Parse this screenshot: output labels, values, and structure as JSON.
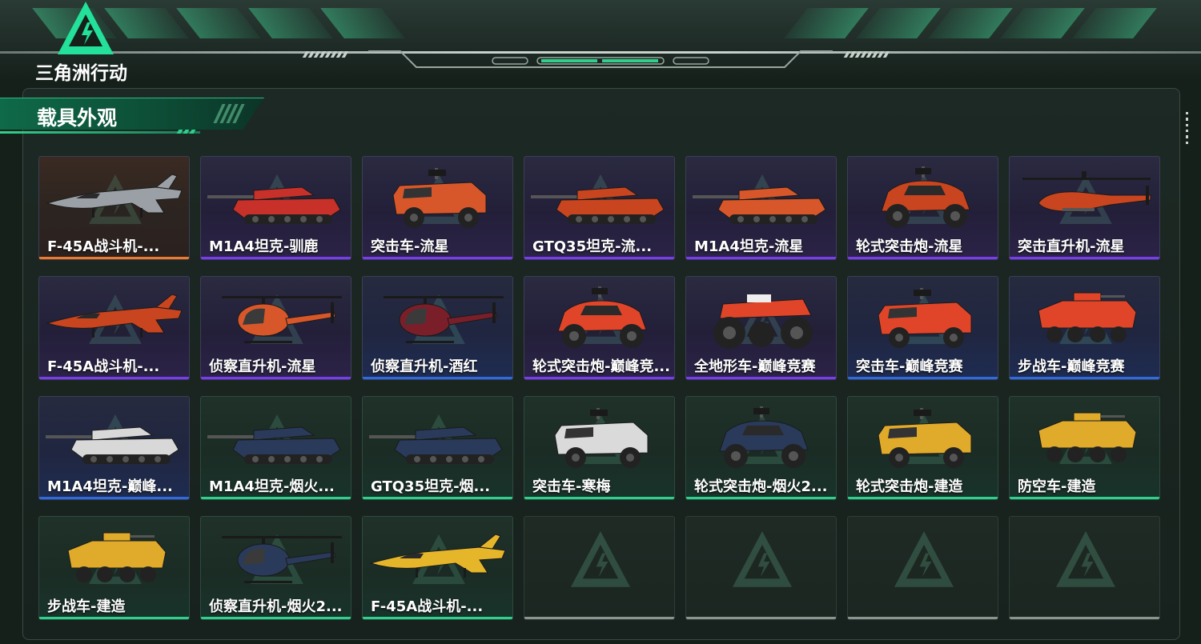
{
  "app": {
    "logo_text": "三角洲行动",
    "section_title": "载具外观"
  },
  "colors": {
    "accent": "#2fd08c",
    "rarity_purple": "#7a3cf0",
    "rarity_blue": "#2f6ae0",
    "rarity_green": "#2fd08c",
    "rarity_orange": "#f07a2a"
  },
  "vehicles": [
    {
      "name": "F-45A战斗机-...",
      "rarity": "orange",
      "type": "jet",
      "livery": "#9aa0a6"
    },
    {
      "name": "M1A4坦克-驯鹿",
      "rarity": "purple",
      "type": "tank",
      "livery": "#c8302a"
    },
    {
      "name": "突击车-流星",
      "rarity": "purple",
      "type": "mrap",
      "livery": "#d8572a"
    },
    {
      "name": "GTQ35坦克-流...",
      "rarity": "purple",
      "type": "tank",
      "livery": "#c8451f"
    },
    {
      "name": "M1A4坦克-流星",
      "rarity": "purple",
      "type": "tank",
      "livery": "#d8572a"
    },
    {
      "name": "轮式突击炮-流星",
      "rarity": "purple",
      "type": "buggy",
      "livery": "#c8451f"
    },
    {
      "name": "突击直升机-流星",
      "rarity": "purple",
      "type": "heli_attack",
      "livery": "#c8451f"
    },
    {
      "name": "F-45A战斗机-...",
      "rarity": "purple",
      "type": "jet",
      "livery": "#c8451f"
    },
    {
      "name": "侦察直升机-流星",
      "rarity": "purple",
      "type": "heli",
      "livery": "#d8572a"
    },
    {
      "name": "侦察直升机-酒红",
      "rarity": "blue",
      "type": "heli",
      "livery": "#7a1f2a"
    },
    {
      "name": "轮式突击炮-巅峰竞...",
      "rarity": "purple",
      "type": "buggy",
      "livery": "#e0452a"
    },
    {
      "name": "全地形车-巅峰竞赛",
      "rarity": "purple",
      "type": "atv",
      "livery": "#e0452a"
    },
    {
      "name": "突击车-巅峰竞赛",
      "rarity": "blue",
      "type": "mrap",
      "livery": "#e0452a"
    },
    {
      "name": "步战车-巅峰竞赛",
      "rarity": "blue",
      "type": "apc",
      "livery": "#e0452a"
    },
    {
      "name": "M1A4坦克-巅峰...",
      "rarity": "blue",
      "type": "tank",
      "livery": "#d8d8d8"
    },
    {
      "name": "M1A4坦克-烟火...",
      "rarity": "green",
      "type": "tank",
      "livery": "#2a3a5a"
    },
    {
      "name": "GTQ35坦克-烟...",
      "rarity": "green",
      "type": "tank",
      "livery": "#2a3a5a"
    },
    {
      "name": "突击车-寒梅",
      "rarity": "green",
      "type": "mrap",
      "livery": "#dadada"
    },
    {
      "name": "轮式突击炮-烟火2...",
      "rarity": "green",
      "type": "buggy",
      "livery": "#2a3a5a"
    },
    {
      "name": "轮式突击炮-建造",
      "rarity": "green",
      "type": "mrap",
      "livery": "#e0aa2a"
    },
    {
      "name": "防空车-建造",
      "rarity": "green",
      "type": "apc",
      "livery": "#e0aa2a"
    },
    {
      "name": "步战车-建造",
      "rarity": "green",
      "type": "apc",
      "livery": "#e0aa2a"
    },
    {
      "name": "侦察直升机-烟火2...",
      "rarity": "green",
      "type": "heli",
      "livery": "#2a3a5a"
    },
    {
      "name": "F-45A战斗机-...",
      "rarity": "green",
      "type": "jet",
      "livery": "#e6b62a"
    },
    {
      "name": "",
      "rarity": "empty",
      "type": "empty",
      "livery": ""
    },
    {
      "name": "",
      "rarity": "empty",
      "type": "empty",
      "livery": ""
    },
    {
      "name": "",
      "rarity": "empty",
      "type": "empty",
      "livery": ""
    },
    {
      "name": "",
      "rarity": "empty",
      "type": "empty",
      "livery": ""
    }
  ]
}
